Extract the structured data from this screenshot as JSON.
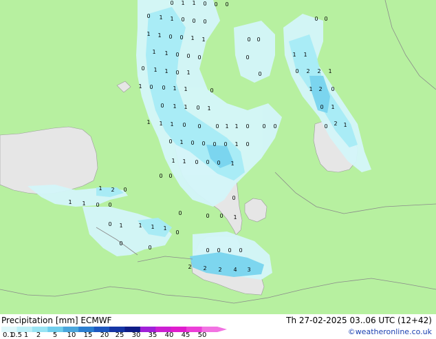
{
  "footer": {
    "title_left": "Precipitation [mm]  ECMWF",
    "title_right": "Th 27-02-2025 03..06 UTC (12+42)",
    "credit": "©weatheronline.co.uk"
  },
  "legend": {
    "ticks": [
      "0.1",
      "0.5",
      "1",
      "2",
      "5",
      "10",
      "15",
      "20",
      "25",
      "30",
      "35",
      "40",
      "45",
      "50"
    ],
    "colors": [
      "#dff8fb",
      "#bdf0f8",
      "#99e4f4",
      "#6fcdec",
      "#4aa6dc",
      "#2b7ed0",
      "#1d57bf",
      "#1535a4",
      "#0f1c86",
      "#a020d8",
      "#cc1fd2",
      "#e01ccd",
      "#ec3fd8",
      "#f273e2"
    ]
  },
  "colors": {
    "land": "#b7f0a0",
    "sea": "#e6e6e6",
    "precip_light": "#d4f6fa",
    "precip_mid": "#a6ebf6",
    "precip_heavy": "#78d4ee",
    "border": "#8a8a8a"
  },
  "map_labels": [
    "0",
    "1",
    "1",
    "0",
    "0",
    "0",
    "0",
    "1",
    "1",
    "0",
    "0",
    "0",
    "1",
    "1",
    "0",
    "0",
    "1",
    "1",
    "1",
    "1",
    "0",
    "0",
    "0",
    "0",
    "1",
    "1",
    "0",
    "1",
    "1",
    "0",
    "0",
    "1",
    "1",
    "0",
    "0",
    "0",
    "0",
    "1",
    "1",
    "0",
    "1",
    "0",
    "1",
    "1",
    "1",
    "0",
    "0",
    "0",
    "0",
    "1",
    "0",
    "0",
    "1",
    "0",
    "0",
    "0",
    "1",
    "0",
    "0",
    "0",
    "2",
    "2",
    "1",
    "1",
    "2",
    "0",
    "1",
    "1",
    "0",
    "0",
    "0",
    "1",
    "0",
    "2",
    "1",
    "0",
    "1",
    "0",
    "1",
    "1",
    "0",
    "0",
    "0",
    "1",
    "1",
    "2",
    "0",
    "1",
    "1",
    "0",
    "0",
    "0",
    "1",
    "1",
    "1",
    "1",
    "0",
    "0",
    "0",
    "1",
    "0",
    "0",
    "0",
    "2",
    "2",
    "2",
    "4",
    "3",
    "0",
    "0",
    "0",
    "0",
    "0",
    "0",
    "0"
  ]
}
